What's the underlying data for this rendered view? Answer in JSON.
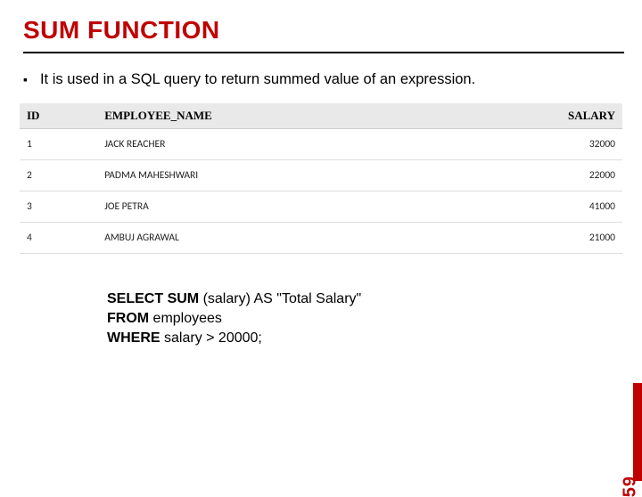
{
  "title": "SUM FUNCTION",
  "bullet": "It is used in a SQL query to return summed value of an expression.",
  "table": {
    "headers": {
      "c0": "ID",
      "c1": "EMPLOYEE_NAME",
      "c2": "SALARY"
    },
    "rows": [
      {
        "id": "1",
        "name": "JACK REACHER",
        "salary": "32000"
      },
      {
        "id": "2",
        "name": "PADMA MAHESHWARI",
        "salary": "22000"
      },
      {
        "id": "3",
        "name": "JOE PETRA",
        "salary": "41000"
      },
      {
        "id": "4",
        "name": "AMBUJ AGRAWAL",
        "salary": "21000"
      }
    ]
  },
  "query": {
    "kw_select": "SELECT SUM",
    "select_rest": " (salary) AS \"Total Salary\"",
    "kw_from": "FROM",
    "from_rest": " employees",
    "kw_where": "WHERE",
    "where_rest": " salary > 20000;"
  },
  "page_number": "59",
  "colors": {
    "accent": "#c00000"
  }
}
